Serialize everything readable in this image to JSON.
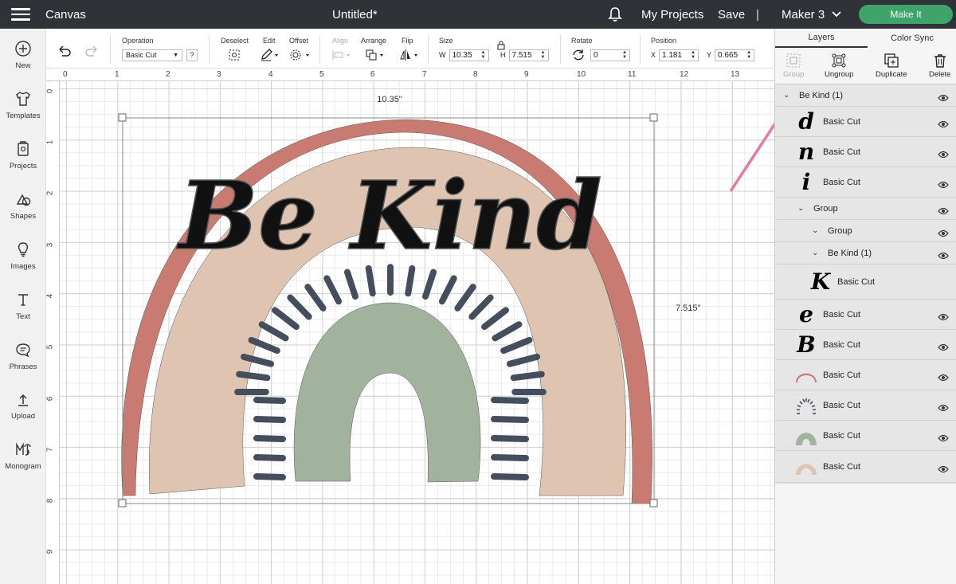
{
  "topbar": {
    "app_title": "Canvas",
    "doc_title": "Untitled*",
    "my_projects": "My Projects",
    "save": "Save",
    "separator": "|",
    "machine": "Maker 3",
    "make_it": "Make It"
  },
  "sidebar": {
    "items": [
      {
        "label": "New",
        "icon": "plus-circle-icon"
      },
      {
        "label": "Templates",
        "icon": "tshirt-icon"
      },
      {
        "label": "Projects",
        "icon": "projects-icon"
      },
      {
        "label": "Shapes",
        "icon": "shapes-icon"
      },
      {
        "label": "Images",
        "icon": "lightbulb-icon"
      },
      {
        "label": "Text",
        "icon": "text-icon"
      },
      {
        "label": "Phrases",
        "icon": "speech-bubble-icon"
      },
      {
        "label": "Upload",
        "icon": "upload-icon"
      },
      {
        "label": "Monogram",
        "icon": "monogram-icon"
      }
    ]
  },
  "toolbar": {
    "operation_label": "Operation",
    "operation_value": "Basic Cut",
    "help": "?",
    "deselect_label": "Deselect",
    "edit_label": "Edit",
    "offset_label": "Offset",
    "align_label": "Align",
    "arrange_label": "Arrange",
    "flip_label": "Flip",
    "size_label": "Size",
    "w_label": "W",
    "w_value": "10.35",
    "h_label": "H",
    "h_value": "7.515",
    "rotate_label": "Rotate",
    "rotate_value": "0",
    "position_label": "Position",
    "x_label": "X",
    "x_value": "1.181",
    "y_label": "Y",
    "y_value": "0.665"
  },
  "rulers": {
    "horizontal": [
      "0",
      "1",
      "2",
      "3",
      "4",
      "5",
      "6",
      "7",
      "8",
      "9",
      "10",
      "11",
      "12",
      "13"
    ],
    "vertical": [
      "0",
      "1",
      "2",
      "3",
      "4",
      "5",
      "6",
      "7",
      "8",
      "9"
    ]
  },
  "canvas": {
    "width_dim": "10.35\"",
    "height_dim": "7.515\"",
    "design_text": "Be Kind",
    "colors": {
      "outer_arc": "#c97b72",
      "mid_arc": "#dfc4b2",
      "inner_arc": "#a1b39d",
      "rays": "#454e5c",
      "text": "#111111"
    }
  },
  "panel": {
    "tabs": [
      {
        "label": "Layers"
      },
      {
        "label": "Color Sync"
      }
    ],
    "actions": [
      {
        "label": "Group",
        "icon": "group-icon",
        "enabled": false
      },
      {
        "label": "Ungroup",
        "icon": "ungroup-icon",
        "enabled": true
      },
      {
        "label": "Duplicate",
        "icon": "duplicate-icon",
        "enabled": true
      },
      {
        "label": "Delete",
        "icon": "trash-icon",
        "enabled": true
      }
    ],
    "layers": [
      {
        "name": "Be Kind (1)",
        "type": "group",
        "thumb": ""
      },
      {
        "name": "Basic Cut",
        "type": "layer",
        "thumb": "d"
      },
      {
        "name": "Basic Cut",
        "type": "layer",
        "thumb": "n"
      },
      {
        "name": "Basic Cut",
        "type": "layer",
        "thumb": "i"
      },
      {
        "name": "Group",
        "type": "group",
        "thumb": ""
      },
      {
        "name": "Group",
        "type": "group",
        "thumb": ""
      },
      {
        "name": "Be Kind (1)",
        "type": "group",
        "thumb": ""
      },
      {
        "name": "Basic Cut",
        "type": "layer",
        "thumb": "K"
      },
      {
        "name": "Basic Cut",
        "type": "layer",
        "thumb": "e"
      },
      {
        "name": "Basic Cut",
        "type": "layer",
        "thumb": "B"
      },
      {
        "name": "Basic Cut",
        "type": "layer",
        "thumb": "outer-arc"
      },
      {
        "name": "Basic Cut",
        "type": "layer",
        "thumb": "rays"
      },
      {
        "name": "Basic Cut",
        "type": "layer",
        "thumb": "inner-arc"
      },
      {
        "name": "Basic Cut",
        "type": "layer",
        "thumb": "mid-arc"
      }
    ]
  }
}
